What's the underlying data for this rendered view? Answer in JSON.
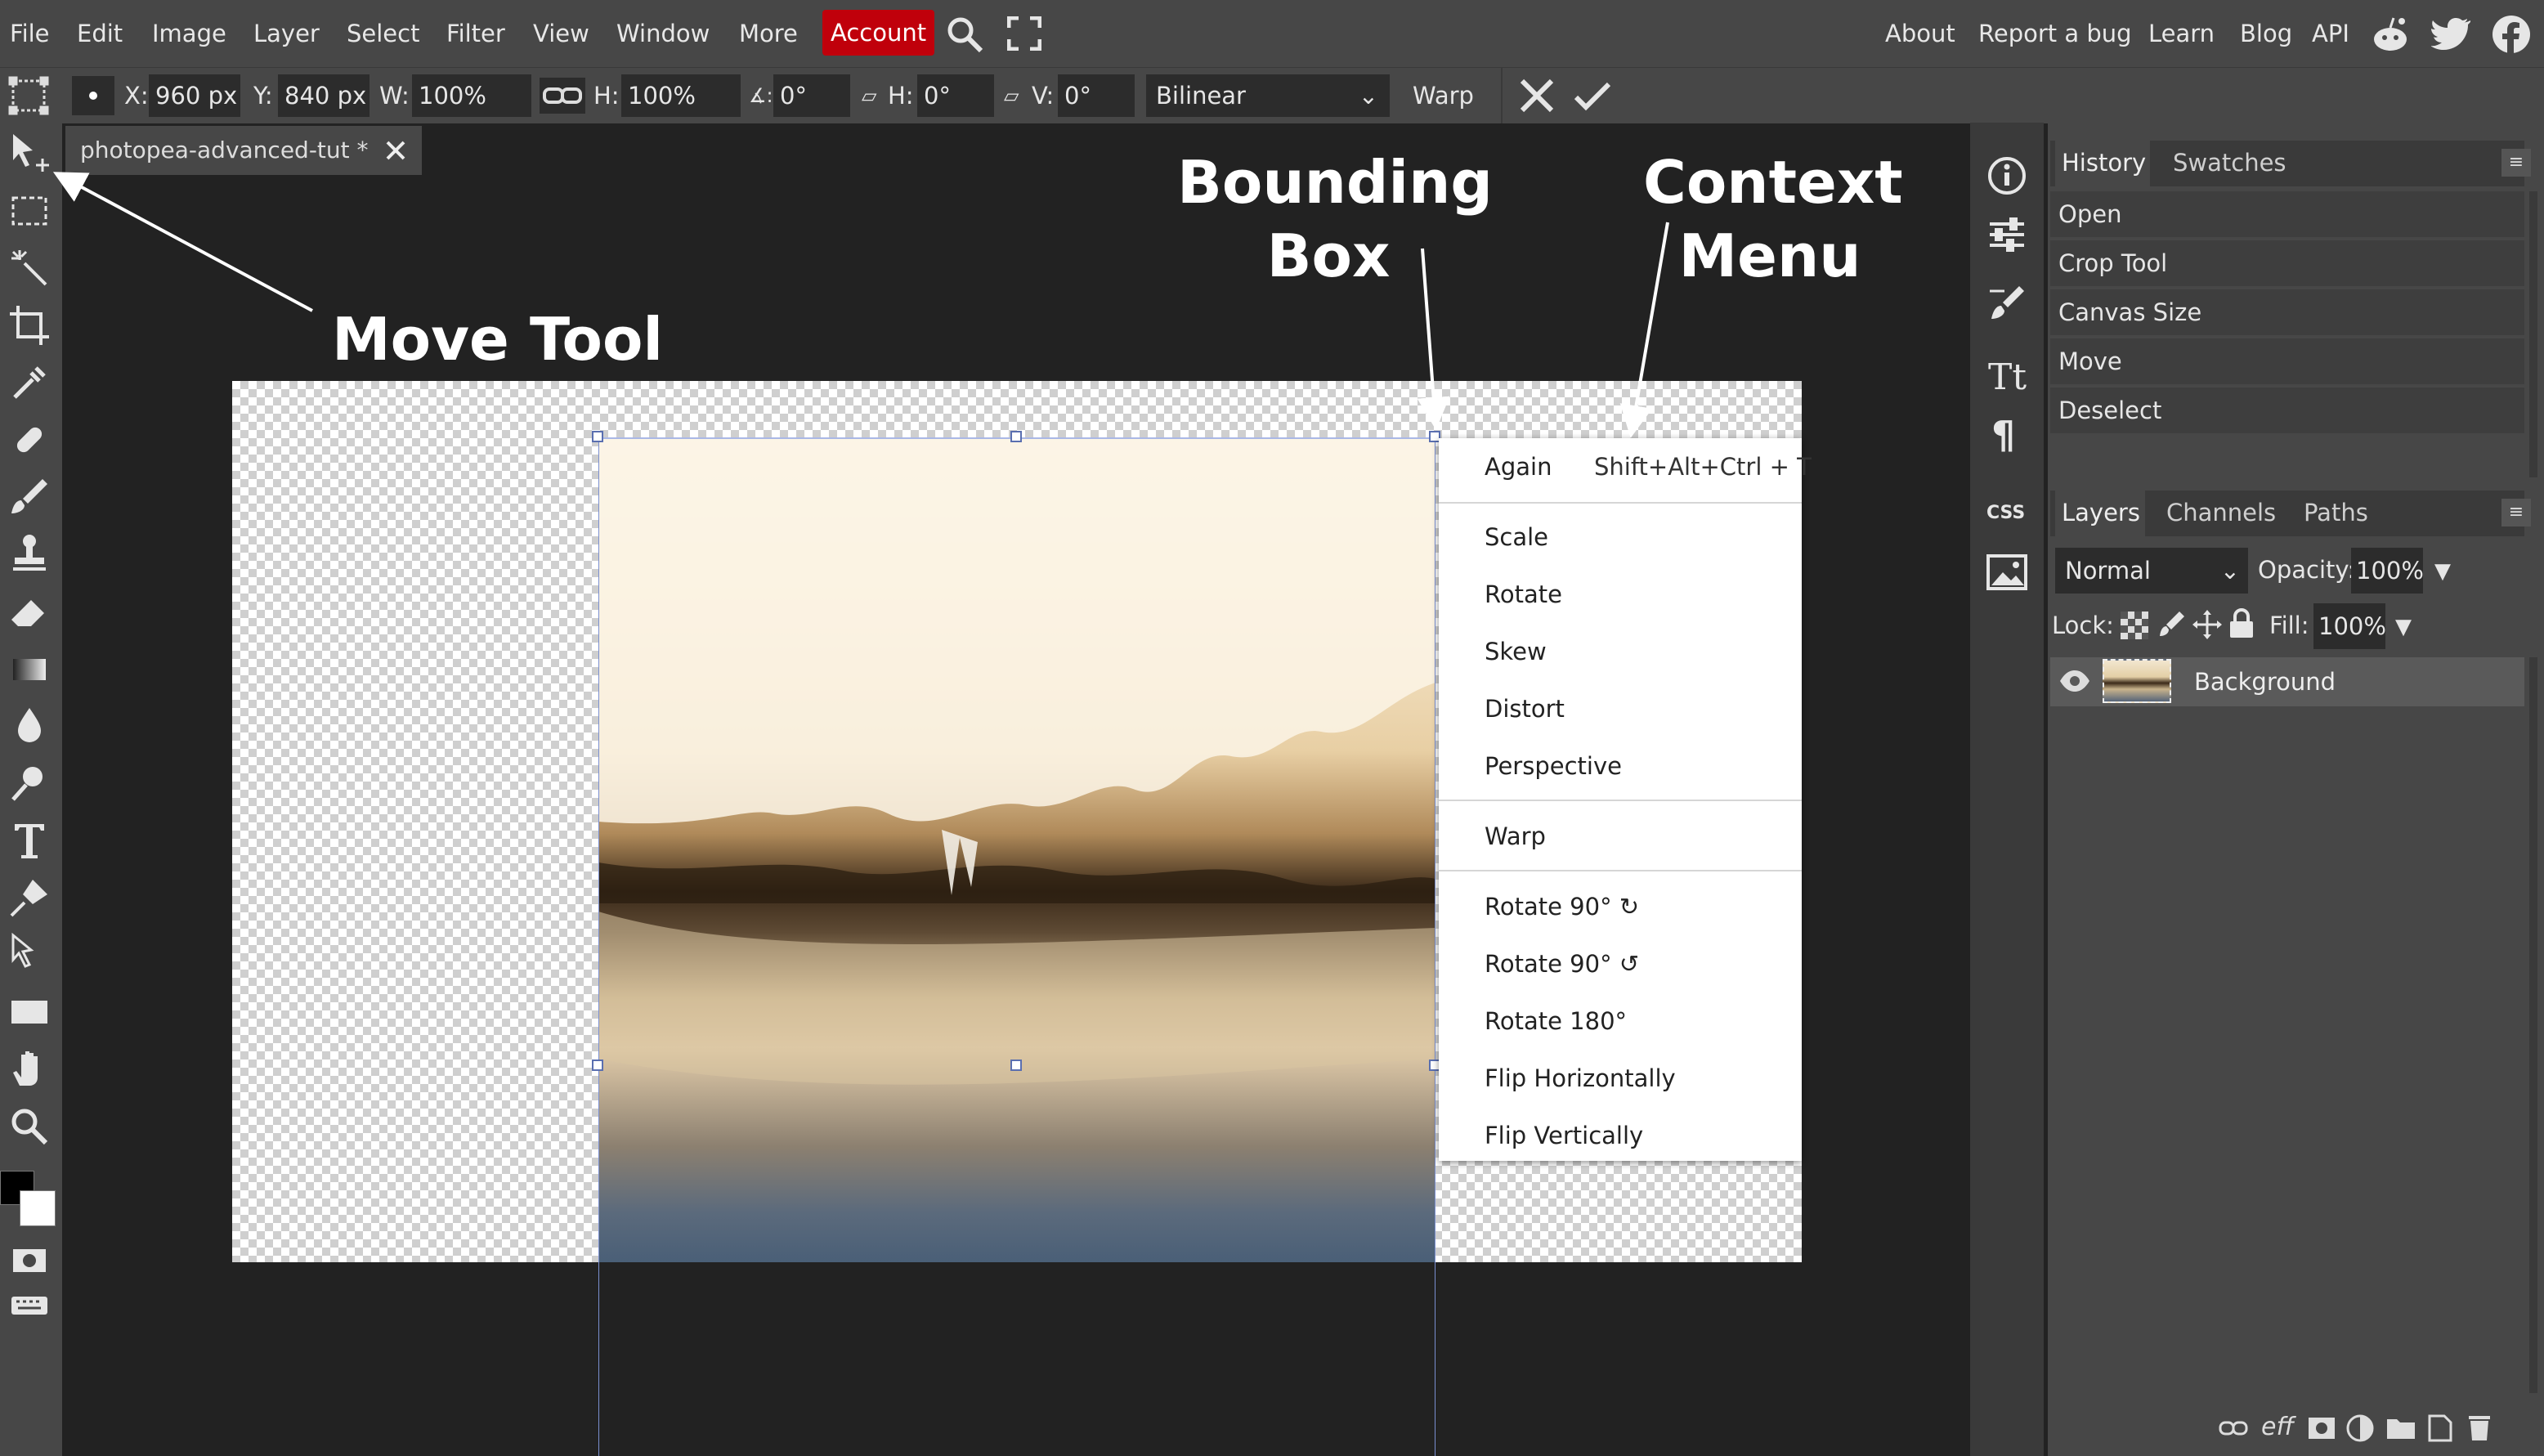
{
  "menubar": {
    "items": [
      "File",
      "Edit",
      "Image",
      "Layer",
      "Select",
      "Filter",
      "View",
      "Window",
      "More"
    ],
    "account": "Account",
    "right_links": [
      "About",
      "Report a bug",
      "Learn",
      "Blog",
      "API"
    ]
  },
  "options": {
    "x_label": "X:",
    "x_value": "960 px",
    "y_label": "Y:",
    "y_value": "840 px",
    "w_label": "W:",
    "w_value": "100%",
    "h_label": "H:",
    "h_value": "100%",
    "angle_value": "0°",
    "skew_h_label": "H:",
    "skew_h_value": "0°",
    "skew_v_label": "V:",
    "skew_v_value": "0°",
    "interpolation": "Bilinear",
    "warp_label": "Warp"
  },
  "document_tab": {
    "title": "photopea-advanced-tut *"
  },
  "annotations": {
    "move_tool": "Move Tool",
    "bounding_box_1": "Bounding",
    "bounding_box_2": "Box",
    "context_menu_1": "Context",
    "context_menu_2": "Menu"
  },
  "context_menu": {
    "again": "Again",
    "again_shortcut": "Shift+Alt+Ctrl + T",
    "scale": "Scale",
    "rotate": "Rotate",
    "skew": "Skew",
    "distort": "Distort",
    "perspective": "Perspective",
    "warp": "Warp",
    "rotate_cw": "Rotate 90° ↻",
    "rotate_ccw": "Rotate 90° ↺",
    "rotate_180": "Rotate 180°",
    "flip_h": "Flip Horizontally",
    "flip_v": "Flip Vertically"
  },
  "history_panel": {
    "tabs": [
      "History",
      "Swatches"
    ],
    "items": [
      "Open",
      "Crop Tool",
      "Canvas Size",
      "Move",
      "Deselect"
    ]
  },
  "layers_panel": {
    "tabs": [
      "Layers",
      "Channels",
      "Paths"
    ],
    "blend_mode": "Normal",
    "opacity_label": "Opacity:",
    "opacity_value": "100%",
    "lock_label": "Lock:",
    "fill_label": "Fill:",
    "fill_value": "100%",
    "layer_name": "Background",
    "footer_eff": "eff"
  },
  "colors": {
    "accent_account": "#c0000b",
    "bg": "#222222",
    "panel": "#474747"
  }
}
